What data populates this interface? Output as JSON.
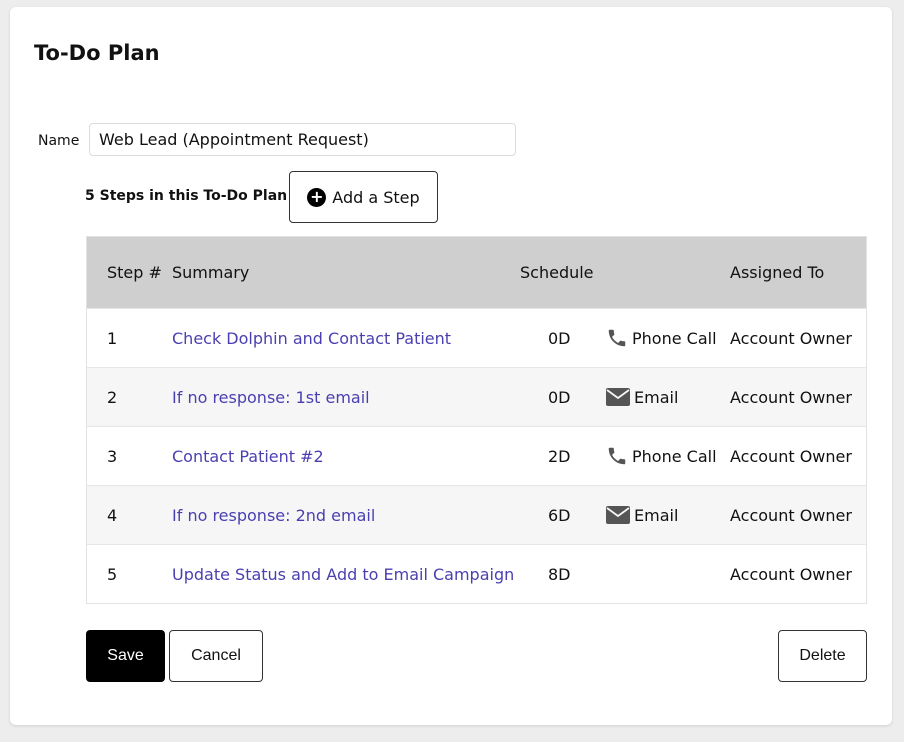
{
  "page": {
    "title": "To-Do Plan"
  },
  "form": {
    "name_label": "Name",
    "name_value": "Web Lead (Appointment Request)",
    "steps_count_text": "5 Steps in this To-Do Plan",
    "add_step_label": "Add a Step"
  },
  "table": {
    "headers": {
      "step": "Step #",
      "summary": "Summary",
      "schedule": "Schedule",
      "assigned": "Assigned To"
    },
    "rows": [
      {
        "step": "1",
        "summary": "Check Dolphin and Contact Patient",
        "schedule": "0D",
        "type": "Phone Call",
        "type_icon": "phone-icon",
        "assigned": "Account Owner"
      },
      {
        "step": "2",
        "summary": "If no response: 1st email",
        "schedule": "0D",
        "type": "Email",
        "type_icon": "envelope-icon",
        "assigned": "Account Owner"
      },
      {
        "step": "3",
        "summary": "Contact Patient #2",
        "schedule": "2D",
        "type": "Phone Call",
        "type_icon": "phone-icon",
        "assigned": "Account Owner"
      },
      {
        "step": "4",
        "summary": "If no response: 2nd email",
        "schedule": "6D",
        "type": "Email",
        "type_icon": "envelope-icon",
        "assigned": "Account Owner"
      },
      {
        "step": "5",
        "summary": "Update Status and Add to Email Campaign",
        "schedule": "8D",
        "type": "",
        "type_icon": "",
        "assigned": "Account Owner"
      }
    ]
  },
  "buttons": {
    "save": "Save",
    "cancel": "Cancel",
    "delete": "Delete"
  },
  "colors": {
    "link": "#4a3fb0",
    "header_bg": "#cfcfcf",
    "primary_button": "#000000"
  }
}
